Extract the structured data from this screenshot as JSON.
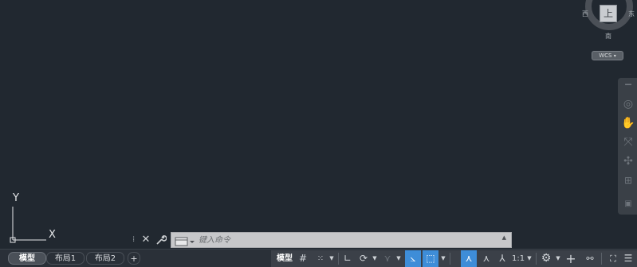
{
  "viewcube": {
    "top_face": "上",
    "west": "西",
    "east": "东",
    "south": "南",
    "wcs_label": "WCS"
  },
  "ucs": {
    "y_label": "Y",
    "x_label": "X"
  },
  "command_line": {
    "placeholder": "键入命令",
    "history_arrow": "▲",
    "close_glyph": "✕",
    "wrench_glyph": "🔧",
    "grip_glyph": "⁞"
  },
  "layout_tabs": [
    {
      "label": "模型",
      "active": true
    },
    {
      "label": "布局1",
      "active": false
    },
    {
      "label": "布局2",
      "active": false
    }
  ],
  "add_layout_label": "+",
  "statusbar": {
    "model_label": "模型",
    "grid_icon": "grid-icon",
    "snap_icon": "snap-icon",
    "ortho_icon": "ortho-icon",
    "polar_icon": "polar-tracking-icon",
    "isodraft_icon": "isometric-drafting-icon",
    "dynucs_icon": "dynamic-ucs-icon",
    "osnap_icon": "object-snap-icon",
    "annotation_icon": "annotation-visibility-icon",
    "autoscale_icon": "autoscale-icon",
    "annotation_scale": "1:1",
    "workspace_icon": "gear-icon",
    "plus_icon": "plus-icon",
    "isolate_icon": "isolate-objects-icon",
    "fullscreen_icon": "fullscreen-icon",
    "menu_icon": "hamburger-menu-icon",
    "accent": "#3e8dd8"
  }
}
